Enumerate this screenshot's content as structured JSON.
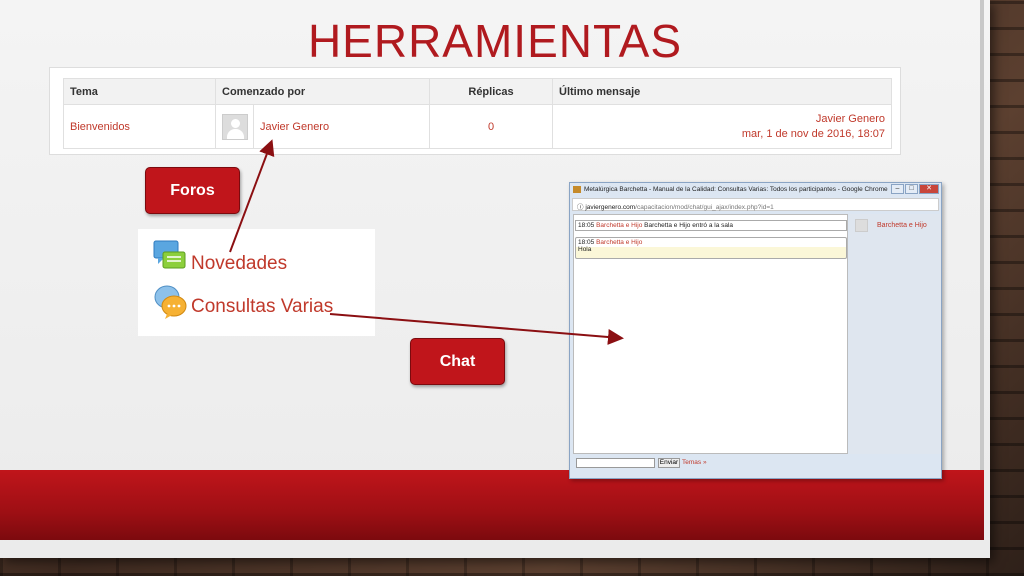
{
  "slide": {
    "title": "HERRAMIENTAS"
  },
  "forum_table": {
    "headers": [
      "Tema",
      "Comenzado por",
      "Réplicas",
      "Último mensaje"
    ],
    "row": {
      "tema": "Bienvenidos",
      "author": "Javier Genero",
      "replies": "0",
      "last_author": "Javier Genero",
      "last_date": "mar, 1 de nov de 2016, 18:07"
    }
  },
  "callouts": {
    "foros": "Foros",
    "chat": "Chat"
  },
  "menu": {
    "items": [
      {
        "label": "Novedades",
        "icon": "forum-icon"
      },
      {
        "label": "Consultas Varias",
        "icon": "chat-bubbles-icon"
      }
    ]
  },
  "chat_window": {
    "title": "Metalúrgica Barchetta - Manual de la Calidad: Consultas Varias: Todos los participantes - Google Chrome",
    "url_host": "javiergenero.com",
    "url_path": "/capacitacion/mod/chat/gui_ajax/index.php?id=1",
    "messages": [
      {
        "time": "18:05",
        "user": "Barchetta e Hijo",
        "text": "Barchetta e Hijo entró a la sala"
      },
      {
        "time": "18:05",
        "user": "Barchetta e Hijo",
        "text": "Hola"
      }
    ],
    "users": [
      "Barchetta e Hijo"
    ],
    "send_label": "Enviar",
    "themes_label": "Temas »"
  },
  "colors": {
    "accent": "#b01a1f",
    "link": "#c0392b",
    "band": "#c0151b"
  }
}
